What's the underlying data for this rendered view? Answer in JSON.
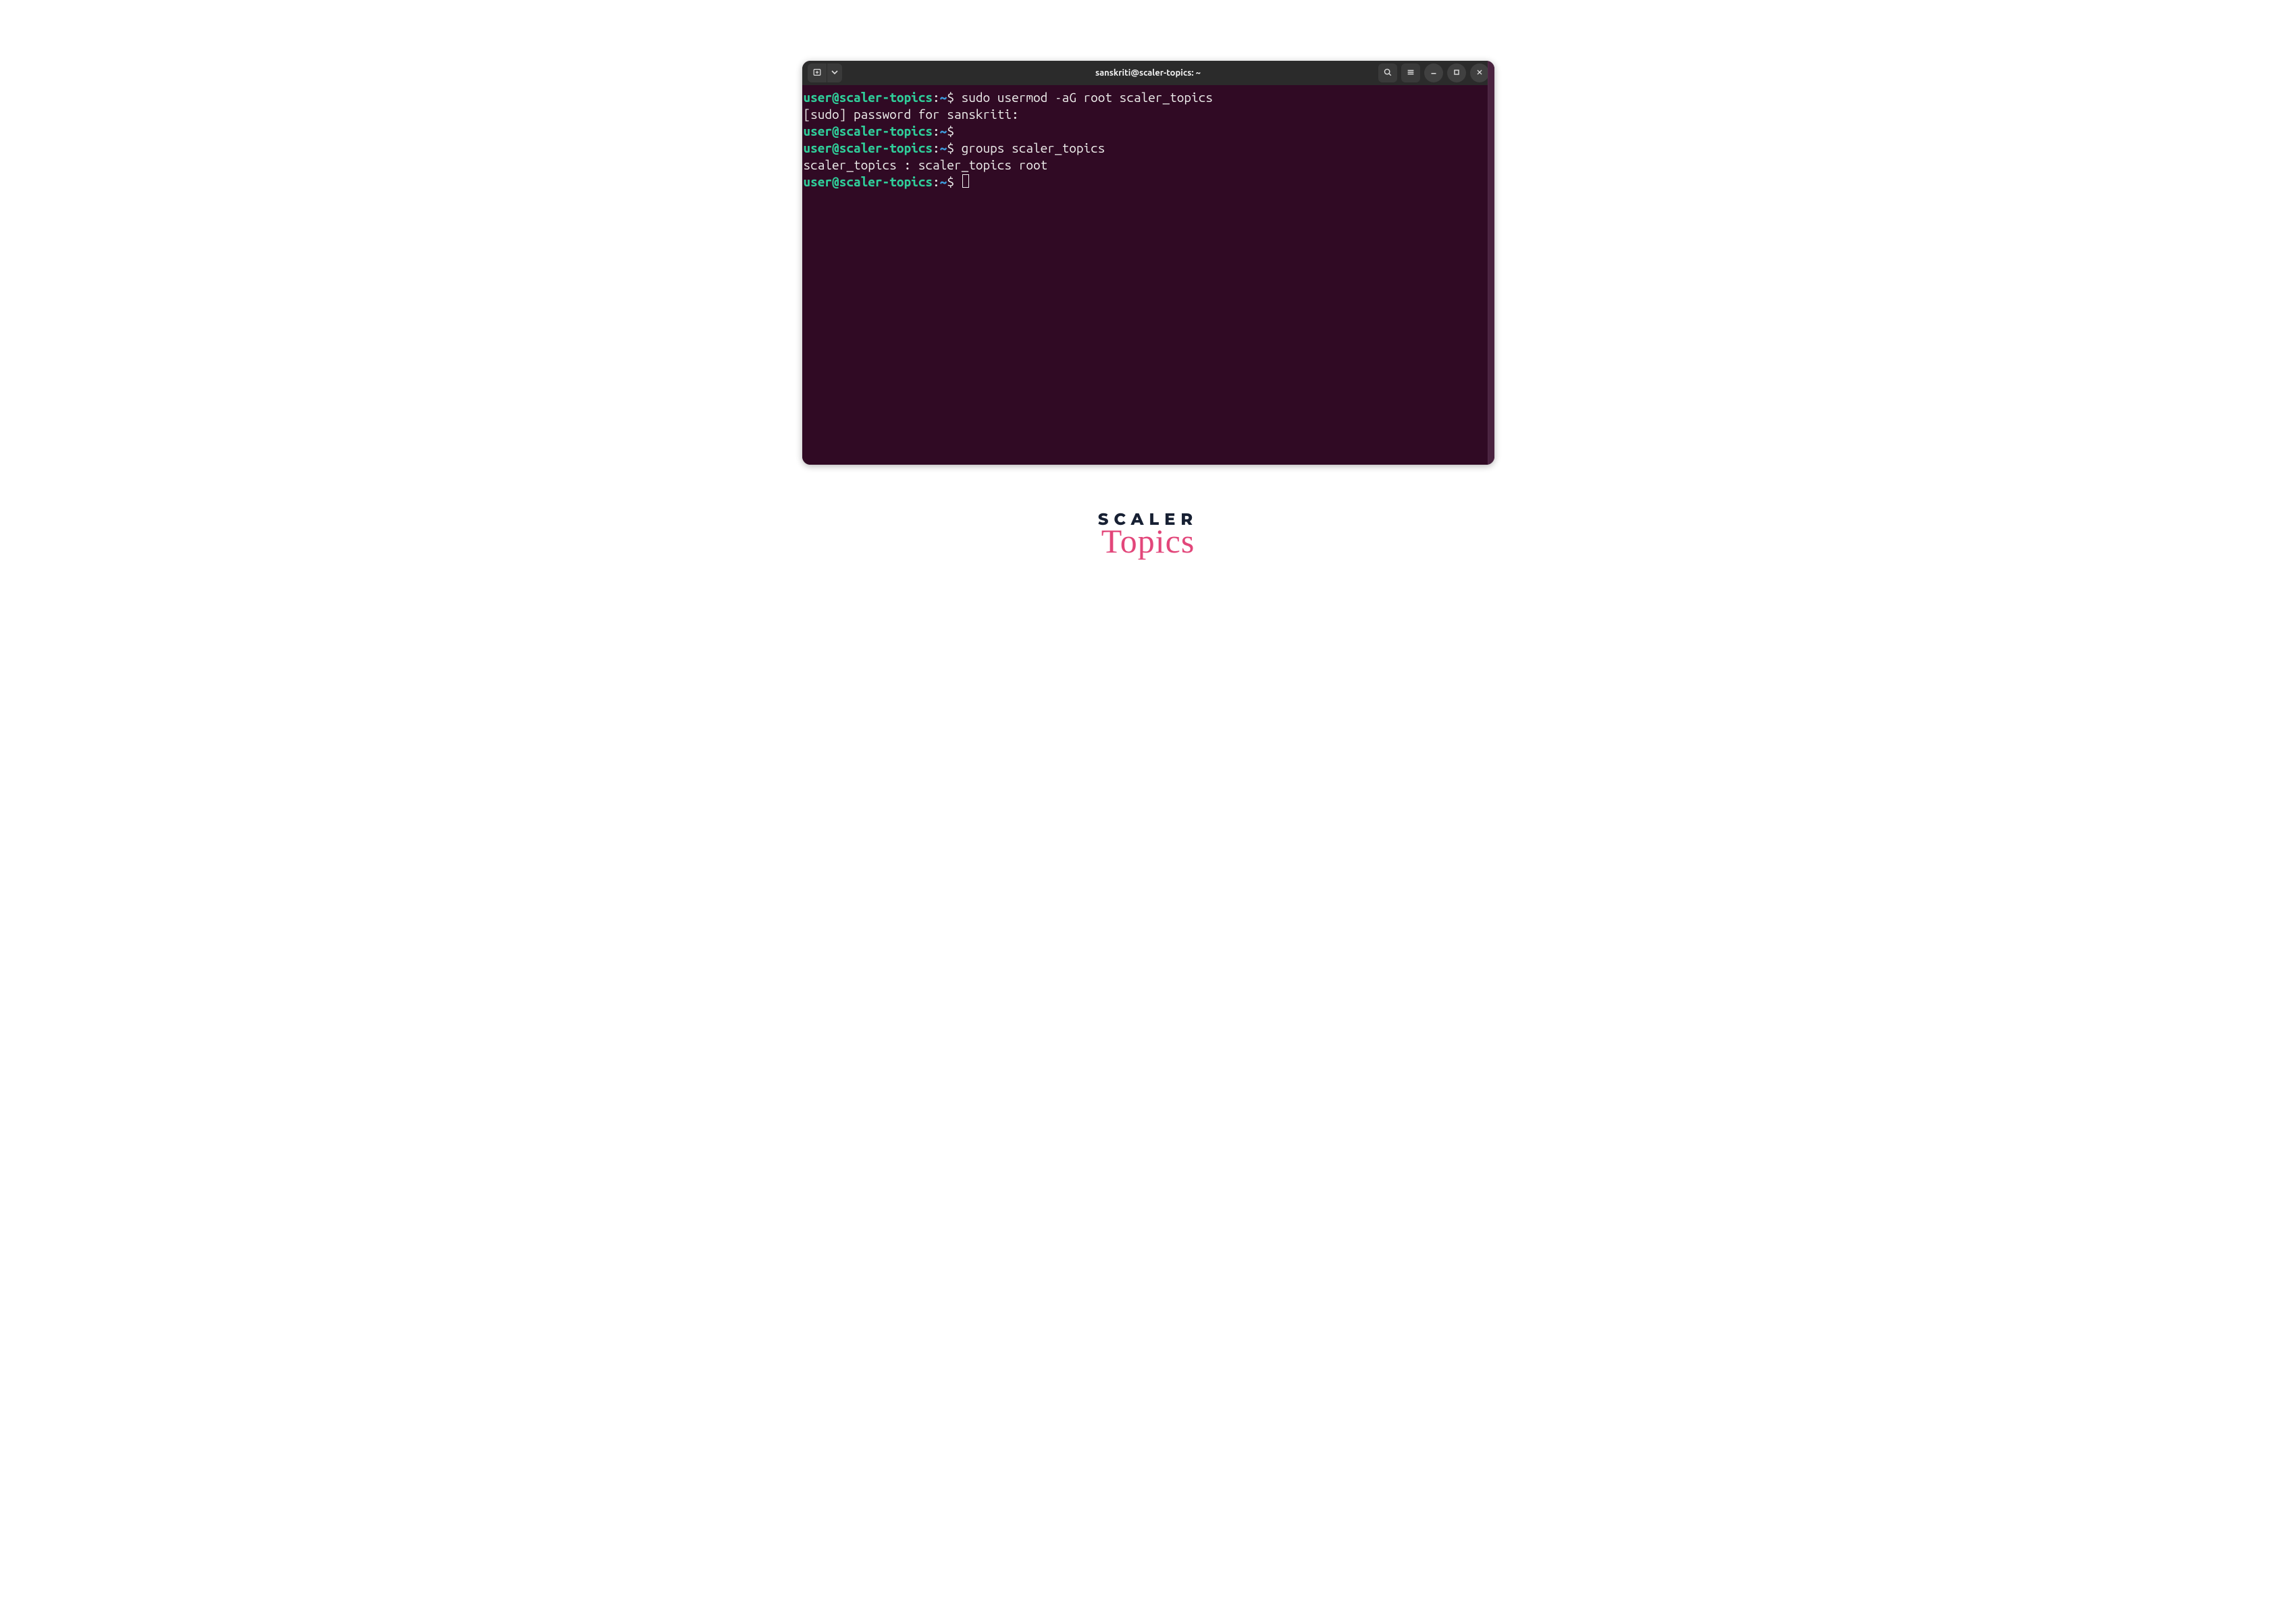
{
  "titlebar": {
    "title": "sanskriti@scaler-topics: ~"
  },
  "terminal": {
    "prompt_user_host": "user@scaler-topics",
    "prompt_path": "~",
    "prompt_symbol": "$",
    "lines": [
      {
        "type": "prompt",
        "command": "sudo usermod -aG root scaler_topics"
      },
      {
        "type": "output",
        "text": "[sudo] password for sanskriti: "
      },
      {
        "type": "prompt",
        "command": ""
      },
      {
        "type": "prompt",
        "command": "groups scaler_topics"
      },
      {
        "type": "output",
        "text": "scaler_topics : scaler_topics root"
      },
      {
        "type": "prompt",
        "command": "",
        "cursor": true
      }
    ]
  },
  "brand": {
    "line1": "SCALER",
    "line2": "Topics"
  }
}
